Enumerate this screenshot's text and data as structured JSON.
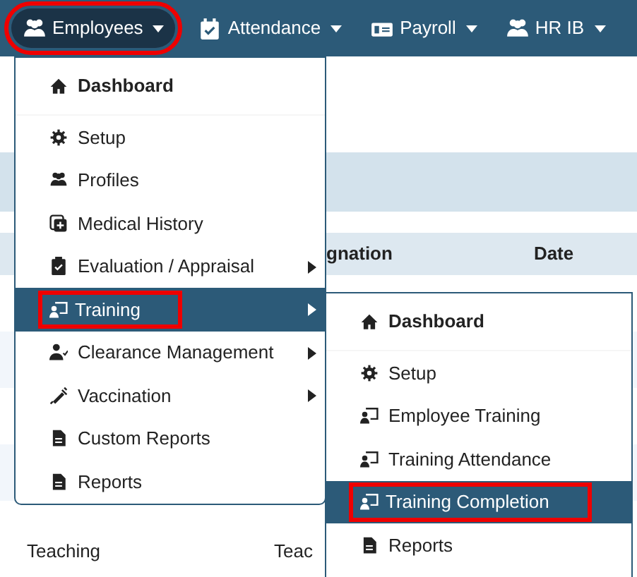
{
  "navbar": [
    {
      "label": "Employees",
      "selected": true,
      "highlighted": true
    },
    {
      "label": "Attendance",
      "selected": false,
      "highlighted": false
    },
    {
      "label": "Payroll",
      "selected": false,
      "highlighted": false
    },
    {
      "label": "HR IB",
      "selected": false,
      "highlighted": false
    }
  ],
  "page": {
    "table_header": [
      "gnation",
      "Date"
    ],
    "last_row": [
      "Teaching",
      "Teac"
    ]
  },
  "employees_menu": [
    {
      "label": "Dashboard",
      "kind": "heading",
      "selected": false,
      "highlighted": false,
      "has_submenu": false
    },
    {
      "label": "Setup",
      "kind": "link",
      "selected": false,
      "highlighted": false,
      "has_submenu": false
    },
    {
      "label": "Profiles",
      "kind": "link",
      "selected": false,
      "highlighted": false,
      "has_submenu": false
    },
    {
      "label": "Medical History",
      "kind": "link",
      "selected": false,
      "highlighted": false,
      "has_submenu": false
    },
    {
      "label": "Evaluation / Appraisal",
      "kind": "link",
      "selected": false,
      "highlighted": false,
      "has_submenu": true
    },
    {
      "label": "Training",
      "kind": "link",
      "selected": true,
      "highlighted": true,
      "has_submenu": true
    },
    {
      "label": "Clearance Management",
      "kind": "link",
      "selected": false,
      "highlighted": false,
      "has_submenu": true
    },
    {
      "label": "Vaccination",
      "kind": "link",
      "selected": false,
      "highlighted": false,
      "has_submenu": true
    },
    {
      "label": "Custom Reports",
      "kind": "link",
      "selected": false,
      "highlighted": false,
      "has_submenu": false
    },
    {
      "label": "Reports",
      "kind": "link",
      "selected": false,
      "highlighted": false,
      "has_submenu": false
    }
  ],
  "training_menu": [
    {
      "label": "Dashboard",
      "kind": "heading",
      "selected": false,
      "highlighted": false
    },
    {
      "label": "Setup",
      "kind": "link",
      "selected": false,
      "highlighted": false
    },
    {
      "label": "Employee Training",
      "kind": "link",
      "selected": false,
      "highlighted": false
    },
    {
      "label": "Training Attendance",
      "kind": "link",
      "selected": false,
      "highlighted": false
    },
    {
      "label": "Training Completion",
      "kind": "link",
      "selected": true,
      "highlighted": true
    },
    {
      "label": "Reports",
      "kind": "link",
      "selected": false,
      "highlighted": false
    }
  ]
}
